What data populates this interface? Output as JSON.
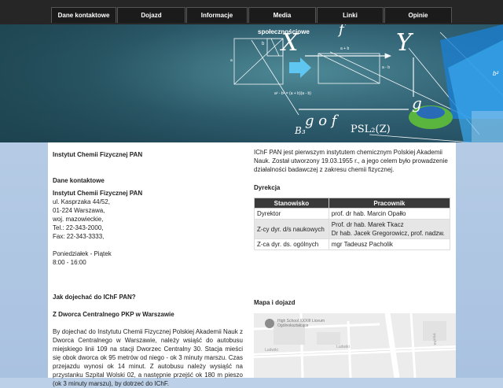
{
  "nav": {
    "items": [
      "Dane kontaktowe",
      "Dojazd",
      "Informacje",
      "Media",
      "Linki",
      "Opinie"
    ]
  },
  "banner": {
    "caption": "społecznościowe",
    "letters": {
      "x": "X",
      "y": "Y",
      "f": "f",
      "g": "g",
      "gof": "g o f",
      "psl": "PSL₂(Z)",
      "b3": "B₃",
      "b2": "b²"
    },
    "formula": "a² - b² = (a + b)(a - b)",
    "labels": {
      "a": "a",
      "b": "b",
      "apb": "a + b",
      "amb": "a - b"
    }
  },
  "left": {
    "heading": "Instytut Chemii Fizycznej PAN",
    "contact_title": "Dane kontaktowe",
    "org": "Instytut Chemii Fizycznej PAN",
    "address": [
      "ul. Kasprzaka 44/52,",
      "01-224 Warszawa,",
      "woj. mazowieckie,",
      "Tel.: 22-343-2000,",
      "Fax: 22-343-3333,"
    ],
    "hours_days": "Poniedziałek - Piątek",
    "hours_time": "8:00 - 16:00",
    "directions_title": "Jak dojechać do IChF PAN?",
    "station_title": "Z Dworca Centralnego PKP w Warszawie",
    "directions_text": "By dojechać do Instytutu Chemii Fizycznej Polskiej Akademii Nauk z Dworca Centralnego w Warszawie, należy wsiąść do autobusu miejskiego linii 109 na stacji Dworzec Centralny 30. Stacja mieści się obok dworca ok 95 metrów od niego - ok 3 minuty marszu. Czas przejazdu wynosi ok 14 minut. Z autobusu należy wysiąść na przystanku Szpital Wolski 02, a następnie przejść ok 180 m pieszo (ok 3 minuty marszu), by dotrzeć do IChF."
  },
  "right": {
    "intro": "IChF PAN jest pierwszym instytutem chemicznym Polskiej Akademii Nauk. Został utworzony 19.03.1955 r., a jego celem było prowadzenie działalności badawczej z zakresu chemii fizycznej.",
    "dyrekcja_title": "Dyrekcja",
    "table": {
      "headers": [
        "Stanowisko",
        "Pracownik"
      ],
      "rows": [
        {
          "position": "Dyrektor",
          "people": [
            "prof. dr hab. Marcin Opałło"
          ]
        },
        {
          "position": "Z-cy dyr. d/s naukowych",
          "people": [
            "Prof. dr hab. Marek Tkacz",
            "Dr hab. Jacek Gregorowicz, prof. nadzw."
          ]
        },
        {
          "position": "Z-ca dyr. ds. ogólnych",
          "people": [
            "mgr Tadeusz Pacholik"
          ]
        }
      ]
    },
    "map_title": "Mapa i dojazd",
    "map": {
      "place_name": "High School XXXIII Liceum Ogólnokształcące",
      "streets": [
        "Płocka",
        "Ludwiki",
        "Ludwiki"
      ]
    }
  },
  "colors": {
    "nav_bg": "#262626",
    "banner": "#2c5a6a",
    "page_bg": "#b3c9e4",
    "table_head": "#3a3a3a"
  }
}
